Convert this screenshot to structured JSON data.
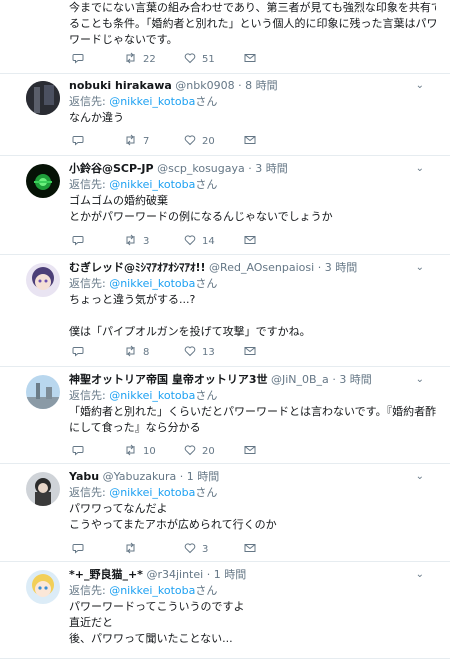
{
  "top": {
    "body": [
      "今までにない言葉の組み合わせであり、第三者が見ても強烈な印象を共有でき",
      "ることも条件。「婚約者と別れた」という個人的に印象に残った言葉はパワー",
      "ワードじゃないです。"
    ],
    "retweets": "22",
    "likes": "51"
  },
  "reply_prefix": "返信先: ",
  "reply_suffix": "さん",
  "tweets": [
    {
      "name": "nobuki hirakawa",
      "handle": "@nbk0908",
      "time": "8 時間",
      "mention": "@nikkei_kotoba",
      "body": [
        "なんか違う"
      ],
      "retweets": "7",
      "likes": "20"
    },
    {
      "name": "小鈴谷@SCP-JP",
      "handle": "@scp_kosugaya",
      "time": "3 時間",
      "mention": "@nikkei_kotoba",
      "body": [
        "ゴムゴムの婚約破棄",
        "とかがパワーワードの例になるんじゃないでしょうか"
      ],
      "retweets": "3",
      "likes": "14"
    },
    {
      "name": "むぎレッド@ﾐｼﾏｱｵｱｵｼﾏｱｵ!!",
      "handle": "@Red_AOsenpaiosi",
      "time": "3 時間",
      "mention": "@nikkei_kotoba",
      "body": [
        "ちょっと違う気がする...?",
        "",
        "僕は「パイプオルガンを投げて攻撃」ですかね。"
      ],
      "retweets": "8",
      "likes": "13"
    },
    {
      "name": "神聖オットリア帝国 皇帝オットリア3世",
      "handle": "@JiN_0B_a",
      "time": "3 時間",
      "mention": "@nikkei_kotoba",
      "body": [
        "「婚約者と別れた」くらいだとパワーワードとは言わないです。『婚約者酢豚",
        "にして食った』なら分かる"
      ],
      "retweets": "10",
      "likes": "20"
    },
    {
      "name": "Yabu",
      "handle": "@Yabuzakura",
      "time": "1 時間",
      "mention": "@nikkei_kotoba",
      "body": [
        "パワワってなんだよ",
        "こうやってまたアホが広められて行くのか"
      ],
      "retweets": "",
      "likes": "3"
    },
    {
      "name": "*+_野良猫_+*",
      "handle": "@r34jintei",
      "time": "1 時間",
      "mention": "@nikkei_kotoba",
      "body": [
        "パワーワードってこういうのですよ",
        "直近だと",
        "後、パワワって聞いたことない..."
      ],
      "retweets": "",
      "likes": ""
    }
  ],
  "colors": {
    "text": "#14171a",
    "secondary": "#657786",
    "link": "#1da1f2",
    "divider": "#e6ecf0"
  }
}
